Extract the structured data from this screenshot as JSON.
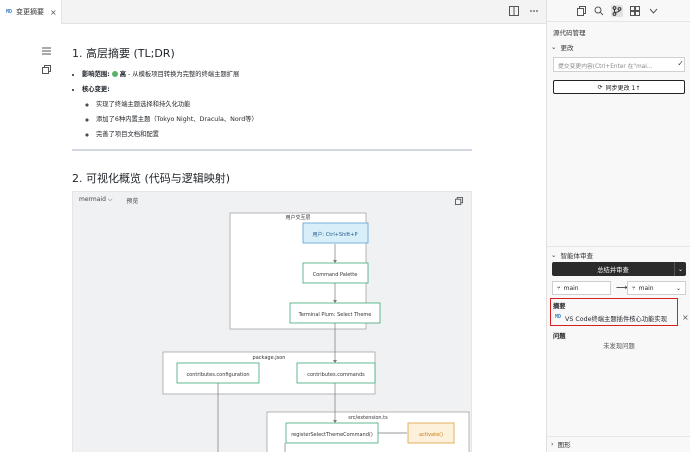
{
  "tab": {
    "type_badge": "MD",
    "title": "变更摘要",
    "close": "×"
  },
  "editor": {
    "section1": {
      "heading": "1. 高层摘要 (TL;DR)",
      "impact_label": "影响范围:",
      "impact_value": "高",
      "impact_desc": " - 从模板项目转换为完整的终端主题扩展",
      "core_label": "核心变更:",
      "changes": [
        "实现了终端主题选择和持久化功能",
        "添加了6种内置主题（Tokyo Night、Dracula、Nord等）",
        "完善了项目文档和配置"
      ]
    },
    "section2": {
      "heading": "2. 可视化概览 (代码与逻辑映射)"
    },
    "mermaid": {
      "lang": "mermaid",
      "preview": "预览",
      "nodes": {
        "ui_group": "用户交互层",
        "user": "用户: Ctrl+Shift+P",
        "palette": "Command Palette",
        "terminal": "Terminal Plum: Select Theme",
        "pkg_group": "package.json",
        "config": "contributes.configuration",
        "commands": "contributes.commands",
        "ext_group": "src/extension.ts",
        "register": "registerSelectThemeCommand()",
        "activate": "activate()"
      }
    }
  },
  "panel": {
    "title": "源代码管理",
    "changes_header": "更改",
    "commit_placeholder": "提交变更内容(Ctrl+Enter 在\"mai...",
    "sync_button": "同步更改 1↑",
    "review_header": "智能体审查",
    "review_button": "总结并审查",
    "branch_from": "main",
    "branch_to": "main",
    "summary_label": "摘要",
    "summary_badge": "MD",
    "summary_item": "VS Code终端主题插件核心功能实现",
    "issues_label": "问题",
    "no_issues": "未发现问题",
    "graph_header": "图形"
  },
  "colors": {
    "node_green": "#3aa776",
    "user_fill": "#d8eef9",
    "user_border": "#5aa0d6",
    "activate_fill": "#fdf1dc",
    "activate_border": "#e0a040",
    "highlight": "#d81e1e"
  }
}
